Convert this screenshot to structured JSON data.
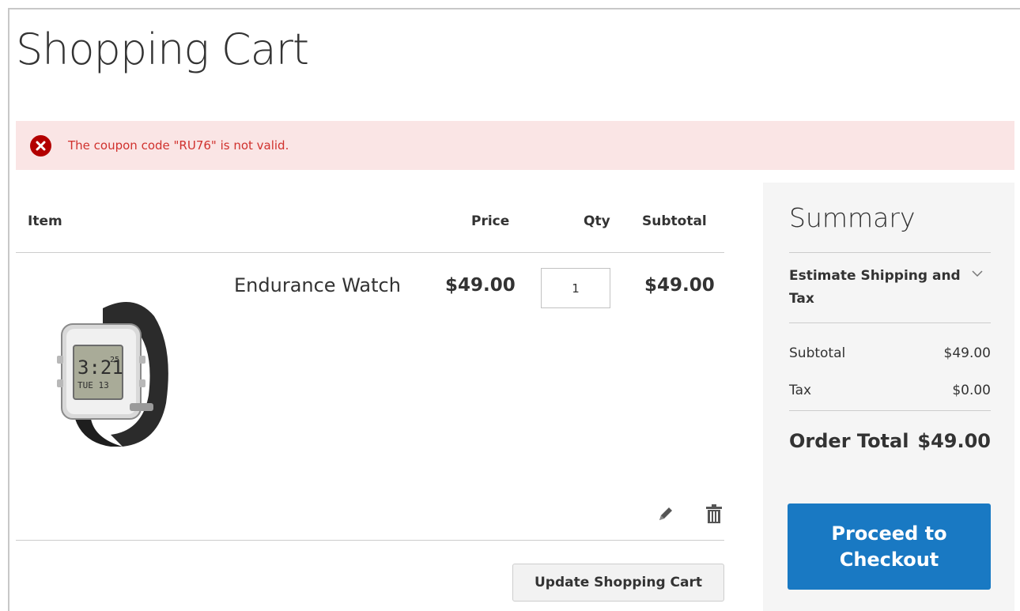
{
  "page": {
    "title": "Shopping Cart"
  },
  "alert": {
    "message": "The coupon code \"RU76\" is not valid.",
    "icon": "error-x-icon",
    "color": "#b30000"
  },
  "cart": {
    "columns": {
      "item": "Item",
      "price": "Price",
      "qty": "Qty",
      "subtotal": "Subtotal"
    },
    "items": [
      {
        "name": "Endurance Watch",
        "price": "$49.00",
        "qty": "1",
        "subtotal": "$49.00",
        "image_icon": "wristwatch-image",
        "watch_display": {
          "time": "3:21",
          "seconds": "25",
          "day": "TUE 13"
        }
      }
    ],
    "edit_icon": "pencil-icon",
    "delete_icon": "trash-icon",
    "update_label": "Update Shopping Cart"
  },
  "summary": {
    "title": "Summary",
    "estimate_label": "Estimate Shipping and Tax",
    "estimate_icon": "chevron-down-icon",
    "rows": [
      {
        "label": "Subtotal",
        "value": "$49.00"
      },
      {
        "label": "Tax",
        "value": "$0.00"
      }
    ],
    "order_total_label": "Order Total",
    "order_total_value": "$49.00",
    "checkout_label": "Proceed to Checkout",
    "checkout_color": "#1979c3"
  }
}
